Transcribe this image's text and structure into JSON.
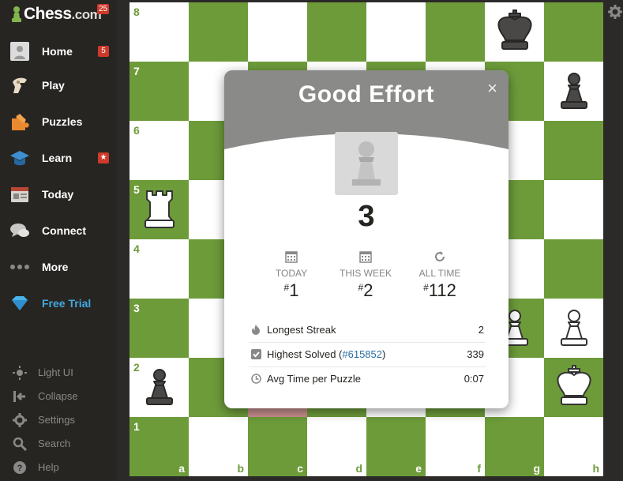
{
  "sidebar": {
    "logo_text": "Chess",
    "logo_suffix": ".com",
    "logo_badge": "25",
    "items": [
      {
        "label": "Home",
        "badge": "5"
      },
      {
        "label": "Play"
      },
      {
        "label": "Puzzles"
      },
      {
        "label": "Learn",
        "badge": "★"
      },
      {
        "label": "Today"
      },
      {
        "label": "Connect"
      },
      {
        "label": "More"
      },
      {
        "label": "Free Trial"
      }
    ],
    "bottom": [
      {
        "label": "Light UI"
      },
      {
        "label": "Collapse"
      },
      {
        "label": "Settings"
      },
      {
        "label": "Search"
      },
      {
        "label": "Help"
      }
    ]
  },
  "board": {
    "ranks": [
      "8",
      "7",
      "6",
      "5",
      "4",
      "3",
      "2",
      "1"
    ],
    "files": [
      "a",
      "b",
      "c",
      "d",
      "e",
      "f",
      "g",
      "h"
    ]
  },
  "modal": {
    "title": "Good Effort",
    "close": "×",
    "score": "3",
    "stats": [
      {
        "label": "TODAY",
        "prefix": "#",
        "value": "1"
      },
      {
        "label": "THIS WEEK",
        "prefix": "#",
        "value": "2"
      },
      {
        "label": "ALL TIME",
        "prefix": "#",
        "value": "112"
      }
    ],
    "rows": [
      {
        "label": "Longest Streak",
        "value": "2"
      },
      {
        "label": "Highest Solved (",
        "link": "#615852",
        "label_end": ")",
        "value": "339"
      },
      {
        "label": "Avg Time per Puzzle",
        "value": "0:07"
      }
    ]
  },
  "colors": {
    "board_dark": "#6d9b3a",
    "board_light": "#ffffff",
    "sidebar_bg": "#272522",
    "badge": "#cd3a2b",
    "trial_accent": "#41a8e0",
    "modal_header": "#8a8a88"
  }
}
